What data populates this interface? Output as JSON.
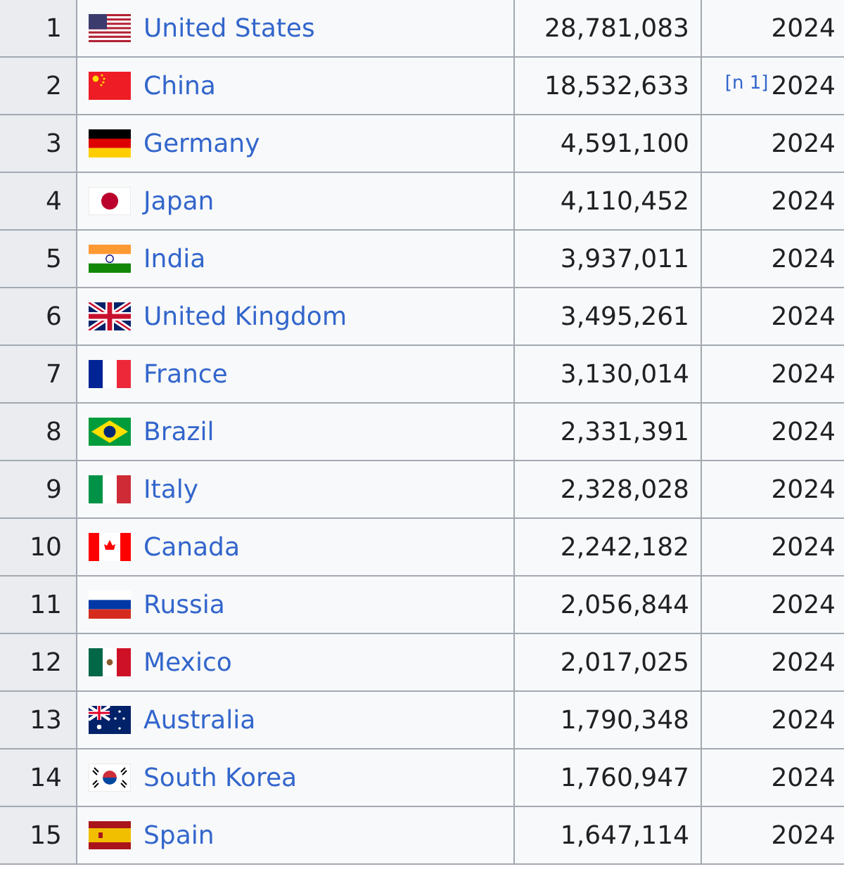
{
  "table": {
    "rows": [
      {
        "rank": "1",
        "country": "United States",
        "gdp": "28,781,083",
        "year": "2024"
      },
      {
        "rank": "2",
        "country": "China",
        "gdp": "18,532,633",
        "note": "[n 1]",
        "year": "2024"
      },
      {
        "rank": "3",
        "country": "Germany",
        "gdp": "4,591,100",
        "year": "2024"
      },
      {
        "rank": "4",
        "country": "Japan",
        "gdp": "4,110,452",
        "year": "2024"
      },
      {
        "rank": "5",
        "country": "India",
        "gdp": "3,937,011",
        "year": "2024"
      },
      {
        "rank": "6",
        "country": "United Kingdom",
        "gdp": "3,495,261",
        "year": "2024"
      },
      {
        "rank": "7",
        "country": "France",
        "gdp": "3,130,014",
        "year": "2024"
      },
      {
        "rank": "8",
        "country": "Brazil",
        "gdp": "2,331,391",
        "year": "2024"
      },
      {
        "rank": "9",
        "country": "Italy",
        "gdp": "2,328,028",
        "year": "2024"
      },
      {
        "rank": "10",
        "country": "Canada",
        "gdp": "2,242,182",
        "year": "2024"
      },
      {
        "rank": "11",
        "country": "Russia",
        "gdp": "2,056,844",
        "year": "2024"
      },
      {
        "rank": "12",
        "country": "Mexico",
        "gdp": "2,017,025",
        "year": "2024"
      },
      {
        "rank": "13",
        "country": "Australia",
        "gdp": "1,790,348",
        "year": "2024"
      },
      {
        "rank": "14",
        "country": "South Korea",
        "gdp": "1,760,947",
        "year": "2024"
      },
      {
        "rank": "15",
        "country": "Spain",
        "gdp": "1,647,114",
        "year": "2024"
      }
    ]
  }
}
